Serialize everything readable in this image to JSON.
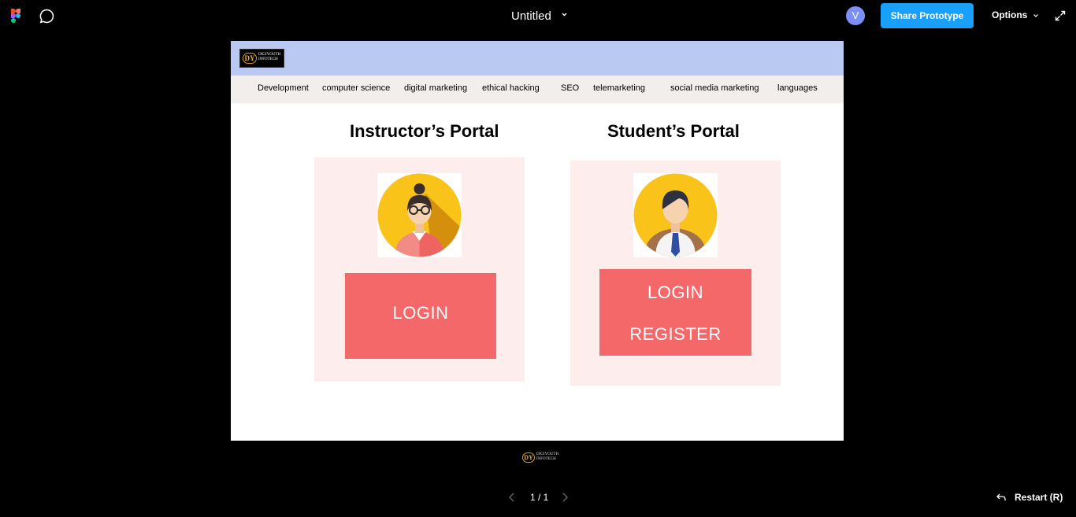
{
  "toolbar": {
    "title": "Untitled",
    "avatar_initial": "V",
    "share_label": "Share Prototype",
    "options_label": "Options"
  },
  "site": {
    "logo_monogram": "DY",
    "logo_line1": "DIGIYOUTH",
    "logo_line2": "INFOTECH",
    "nav": [
      "Development",
      "computer science",
      "digital marketing",
      "ethical hacking",
      "SEO",
      "telemarketing",
      "social media marketing",
      "languages"
    ],
    "instructor": {
      "title": "Instructor’s Portal",
      "login_label": "LOGIN"
    },
    "student": {
      "title": "Student’s Portal",
      "login_label": "LOGIN",
      "register_label": "REGISTER"
    }
  },
  "footer": {
    "pager": "1 / 1",
    "restart_label": "Restart (R)"
  },
  "colors": {
    "share_blue": "#18a0fb",
    "header_blue": "#b9c9f2",
    "nav_bg": "#f2eeec",
    "card_pink": "#fdeded",
    "button_coral": "#f4686a",
    "avatar_yellow": "#f9c31a"
  },
  "icons": [
    "figma-logo-icon",
    "comment-icon",
    "chevron-down-icon",
    "expand-icon",
    "chevron-left-icon",
    "chevron-right-icon",
    "restart-arrow-icon"
  ]
}
